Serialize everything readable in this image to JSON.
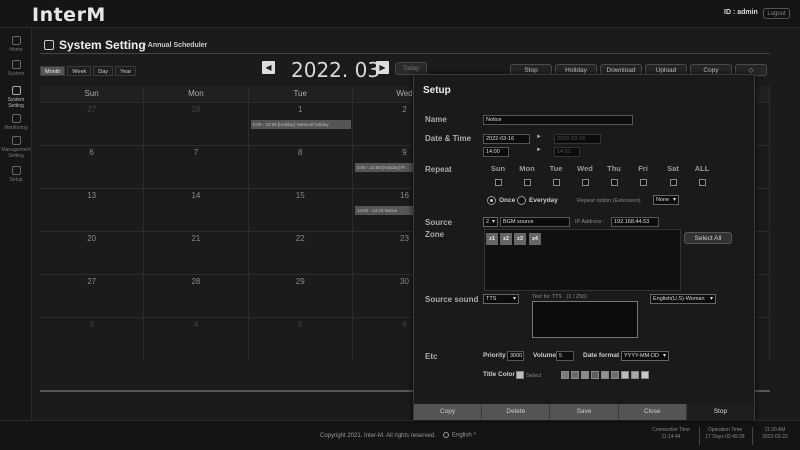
{
  "app": {
    "logo": "InterM",
    "user_id": "ID : admin",
    "logout": "Logout"
  },
  "sidebar": {
    "items": [
      {
        "label": "Home"
      },
      {
        "label": "System"
      },
      {
        "label": "System Setting"
      },
      {
        "label": "Monitoring"
      },
      {
        "label": "Management Setting"
      },
      {
        "label": "Setup"
      }
    ]
  },
  "header": {
    "title": "System Setting",
    "breadcrumb": "> Annual Scheduler"
  },
  "toolbar": {
    "view_tabs": [
      "Month",
      "Week",
      "Day",
      "Year"
    ],
    "prev": "◀",
    "next": "▶",
    "month": "2022. 03",
    "today": "Today",
    "actions": [
      "Stop",
      "Holiday",
      "Download",
      "Upload",
      "Copy",
      "◇"
    ]
  },
  "calendar": {
    "weekdays": [
      "Sun",
      "Mon",
      "Tue",
      "Wed"
    ],
    "weeks": [
      [
        "27",
        "28",
        "1",
        "2"
      ],
      [
        "6",
        "7",
        "8",
        "9"
      ],
      [
        "13",
        "14",
        "15",
        "16"
      ],
      [
        "20",
        "21",
        "22",
        "23"
      ],
      [
        "27",
        "28",
        "29",
        "30"
      ],
      [
        "3",
        "4",
        "5",
        "6"
      ]
    ],
    "events": [
      "0:00 - 23:59 [Holiday] National holiday",
      "0:00 - 23:59 [Holiday] Pr",
      "14:00 - 14:03 Notice"
    ]
  },
  "modal": {
    "title": "Setup",
    "labels": {
      "name": "Name",
      "datetime": "Date & Time",
      "repeat": "Repeat",
      "source": "Source",
      "zone": "Zone",
      "source_sound": "Source sound",
      "etc": "Etc"
    },
    "name_value": "Notice",
    "start_date": "2022-03-16",
    "end_date": "2022-03-16",
    "start_time": "14:00",
    "end_time": "14:01",
    "days": [
      "Sun",
      "Mon",
      "Tue",
      "Wed",
      "Thu",
      "Fri",
      "Sat",
      "ALL"
    ],
    "once": "Once",
    "everyday": "Everyday",
    "repeat_option_label": "Repeat option (Extension)",
    "repeat_option_value": "None",
    "source_num": "2",
    "source_name": "BGM source",
    "ip_label": "IP Address :",
    "ip_value": "192.168.44.53",
    "zones": [
      "z1",
      "z2",
      "z3",
      "z4"
    ],
    "select_all": "Select All",
    "sound_type": "TTS",
    "tts_label": "Text for TTS",
    "tts_count": "(1 / 256)",
    "voice": "English(U.S)-Woman",
    "priority_label": "Priority",
    "priority_value": "3000",
    "volume_label": "Volume",
    "volume_value": "5",
    "date_format_label": "Date format",
    "date_format_value": "YYYY-MM-DD",
    "title_color_label": "Title Color",
    "title_color_select": "Select",
    "swatch_colors": [
      "#7a7a7a",
      "#6a6a6a",
      "#8a8a8a",
      "#5e5e5e",
      "#939393",
      "#6e6e6e",
      "#bdbdbd",
      "#a7a7a7",
      "#c9c9c9"
    ],
    "footer": [
      "Copy",
      "Delete",
      "Save",
      "Close",
      "Stop"
    ]
  },
  "footer": {
    "copyright": "Copyright 2021. Inter-M. All rights reserved.",
    "language": "English",
    "connection_label": "Connection Time",
    "connection_value": "11:14:44",
    "operation_label": "Operation Time",
    "operation_value": "17 Days 02:49:28",
    "clock_time": "11:20 AM",
    "clock_date": "2022-03-23"
  }
}
